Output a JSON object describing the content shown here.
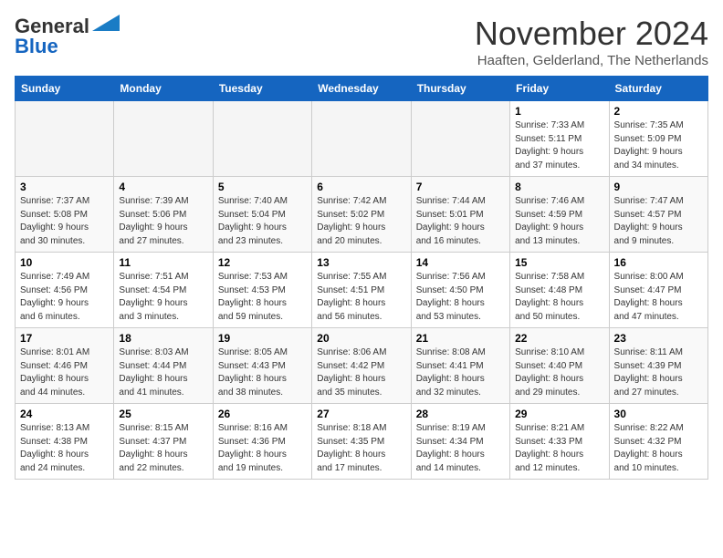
{
  "logo": {
    "line1": "General",
    "line2": "Blue"
  },
  "title": "November 2024",
  "location": "Haaften, Gelderland, The Netherlands",
  "headers": [
    "Sunday",
    "Monday",
    "Tuesday",
    "Wednesday",
    "Thursday",
    "Friday",
    "Saturday"
  ],
  "weeks": [
    [
      {
        "day": "",
        "info": ""
      },
      {
        "day": "",
        "info": ""
      },
      {
        "day": "",
        "info": ""
      },
      {
        "day": "",
        "info": ""
      },
      {
        "day": "",
        "info": ""
      },
      {
        "day": "1",
        "info": "Sunrise: 7:33 AM\nSunset: 5:11 PM\nDaylight: 9 hours\nand 37 minutes."
      },
      {
        "day": "2",
        "info": "Sunrise: 7:35 AM\nSunset: 5:09 PM\nDaylight: 9 hours\nand 34 minutes."
      }
    ],
    [
      {
        "day": "3",
        "info": "Sunrise: 7:37 AM\nSunset: 5:08 PM\nDaylight: 9 hours\nand 30 minutes."
      },
      {
        "day": "4",
        "info": "Sunrise: 7:39 AM\nSunset: 5:06 PM\nDaylight: 9 hours\nand 27 minutes."
      },
      {
        "day": "5",
        "info": "Sunrise: 7:40 AM\nSunset: 5:04 PM\nDaylight: 9 hours\nand 23 minutes."
      },
      {
        "day": "6",
        "info": "Sunrise: 7:42 AM\nSunset: 5:02 PM\nDaylight: 9 hours\nand 20 minutes."
      },
      {
        "day": "7",
        "info": "Sunrise: 7:44 AM\nSunset: 5:01 PM\nDaylight: 9 hours\nand 16 minutes."
      },
      {
        "day": "8",
        "info": "Sunrise: 7:46 AM\nSunset: 4:59 PM\nDaylight: 9 hours\nand 13 minutes."
      },
      {
        "day": "9",
        "info": "Sunrise: 7:47 AM\nSunset: 4:57 PM\nDaylight: 9 hours\nand 9 minutes."
      }
    ],
    [
      {
        "day": "10",
        "info": "Sunrise: 7:49 AM\nSunset: 4:56 PM\nDaylight: 9 hours\nand 6 minutes."
      },
      {
        "day": "11",
        "info": "Sunrise: 7:51 AM\nSunset: 4:54 PM\nDaylight: 9 hours\nand 3 minutes."
      },
      {
        "day": "12",
        "info": "Sunrise: 7:53 AM\nSunset: 4:53 PM\nDaylight: 8 hours\nand 59 minutes."
      },
      {
        "day": "13",
        "info": "Sunrise: 7:55 AM\nSunset: 4:51 PM\nDaylight: 8 hours\nand 56 minutes."
      },
      {
        "day": "14",
        "info": "Sunrise: 7:56 AM\nSunset: 4:50 PM\nDaylight: 8 hours\nand 53 minutes."
      },
      {
        "day": "15",
        "info": "Sunrise: 7:58 AM\nSunset: 4:48 PM\nDaylight: 8 hours\nand 50 minutes."
      },
      {
        "day": "16",
        "info": "Sunrise: 8:00 AM\nSunset: 4:47 PM\nDaylight: 8 hours\nand 47 minutes."
      }
    ],
    [
      {
        "day": "17",
        "info": "Sunrise: 8:01 AM\nSunset: 4:46 PM\nDaylight: 8 hours\nand 44 minutes."
      },
      {
        "day": "18",
        "info": "Sunrise: 8:03 AM\nSunset: 4:44 PM\nDaylight: 8 hours\nand 41 minutes."
      },
      {
        "day": "19",
        "info": "Sunrise: 8:05 AM\nSunset: 4:43 PM\nDaylight: 8 hours\nand 38 minutes."
      },
      {
        "day": "20",
        "info": "Sunrise: 8:06 AM\nSunset: 4:42 PM\nDaylight: 8 hours\nand 35 minutes."
      },
      {
        "day": "21",
        "info": "Sunrise: 8:08 AM\nSunset: 4:41 PM\nDaylight: 8 hours\nand 32 minutes."
      },
      {
        "day": "22",
        "info": "Sunrise: 8:10 AM\nSunset: 4:40 PM\nDaylight: 8 hours\nand 29 minutes."
      },
      {
        "day": "23",
        "info": "Sunrise: 8:11 AM\nSunset: 4:39 PM\nDaylight: 8 hours\nand 27 minutes."
      }
    ],
    [
      {
        "day": "24",
        "info": "Sunrise: 8:13 AM\nSunset: 4:38 PM\nDaylight: 8 hours\nand 24 minutes."
      },
      {
        "day": "25",
        "info": "Sunrise: 8:15 AM\nSunset: 4:37 PM\nDaylight: 8 hours\nand 22 minutes."
      },
      {
        "day": "26",
        "info": "Sunrise: 8:16 AM\nSunset: 4:36 PM\nDaylight: 8 hours\nand 19 minutes."
      },
      {
        "day": "27",
        "info": "Sunrise: 8:18 AM\nSunset: 4:35 PM\nDaylight: 8 hours\nand 17 minutes."
      },
      {
        "day": "28",
        "info": "Sunrise: 8:19 AM\nSunset: 4:34 PM\nDaylight: 8 hours\nand 14 minutes."
      },
      {
        "day": "29",
        "info": "Sunrise: 8:21 AM\nSunset: 4:33 PM\nDaylight: 8 hours\nand 12 minutes."
      },
      {
        "day": "30",
        "info": "Sunrise: 8:22 AM\nSunset: 4:32 PM\nDaylight: 8 hours\nand 10 minutes."
      }
    ]
  ]
}
